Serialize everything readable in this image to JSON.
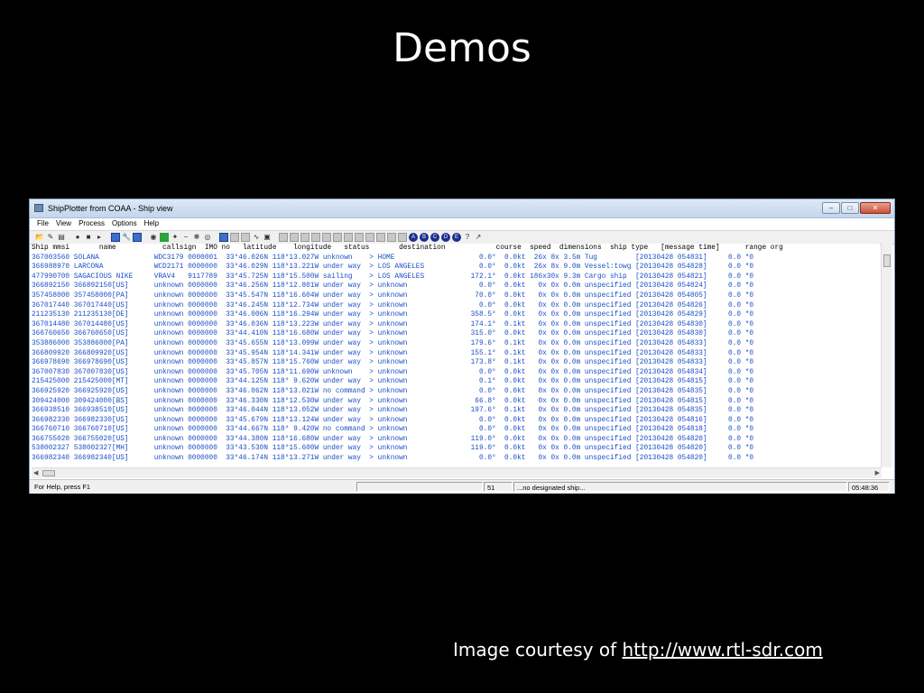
{
  "slide": {
    "title": "Demos",
    "caption_prefix": "Image courtesy of",
    "caption_link": "http://www.rtl-sdr.com"
  },
  "window": {
    "title": "ShipPlotter from COAA - Ship view",
    "controls": [
      "minimize-icon",
      "maximize-icon",
      "close-icon"
    ]
  },
  "menu": [
    "File",
    "View",
    "Process",
    "Options",
    "Help"
  ],
  "table": {
    "header": "Ship mmsi       name           callsign  IMO no   latitude    longitude   status       destination            course  speed  dimensions  ship type   [message time]      range org",
    "rows": [
      "367003560 SOLANA             WDC3179 0000001  33°46.026N 118°13.027W unknown    > HOME                    0.0°  0.0kt  26x 8x 3.5m Tug         [20130428 054831]     0.0 *0",
      "366988970 LARCONA            WCD2171 0000000  33°46.029N 118°13.221W under way  > LOS ANGELES             0.0°  0.0kt  26x 8x 9.0m Vessel:towg [20130428 054828]     0.0 *0",
      "477990700 SAGACIOUS NIKE     VRAV4   9117789  33°45.725N 118°15.500W sailing    > LOS ANGELES           172.1°  0.0kt 186x30x 9.3m Cargo ship  [20130428 054821]     0.0 *0",
      "366892150 366892150[US]      unknown 0000000  33°46.256N 118°12.801W under way  > unknown                 0.0°  0.0kt   0x 0x 0.0m unspecified [20130428 054824]     0.0 *0",
      "357458000 357458000[PA]      unknown 0000000  33°45.547N 118°16.604W under way  > unknown                70.0°  0.0kt   0x 0x 0.0m unspecified [20130428 054805]     0.0 *0",
      "367017440 367017440[US]      unknown 0000000  33°46.245N 118°12.734W under way  > unknown                 0.0°  0.0kt   0x 0x 0.0m unspecified [20130428 054826]     0.0 *0",
      "211235130 211235130[DE]      unknown 0000000  33°46.006N 118°16.294W under way  > unknown               358.5°  0.0kt   0x 0x 0.0m unspecified [20130428 054829]     0.0 *0",
      "367014480 367014480[US]      unknown 0000000  33°46.036N 118°13.223W under way  > unknown               174.1°  0.1kt   0x 0x 0.0m unspecified [20130428 054830]     0.0 *0",
      "366760650 366760650[US]      unknown 0000000  33°44.410N 118°16.680W under way  > unknown               315.0°  0.0kt   0x 0x 0.0m unspecified [20130428 054830]     0.0 *0",
      "353886000 353886000[PA]      unknown 0000000  33°45.655N 118°13.099W under way  > unknown               179.6°  0.1kt   0x 0x 0.0m unspecified [20130428 054833]     0.0 *0",
      "366809920 366809920[US]      unknown 0000000  33°45.954N 118°14.341W under way  > unknown               155.1°  0.1kt   0x 0x 0.0m unspecified [20130428 054833]     0.0 *0",
      "366978690 366978690[US]      unknown 0000000  33°45.857N 118°15.760W under way  > unknown               173.8°  0.1kt   0x 0x 0.0m unspecified [20130428 054833]     0.0 *0",
      "367007830 367007830[US]      unknown 0000000  33°45.705N 118°11.690W unknown    > unknown                 0.0°  0.0kt   0x 0x 0.0m unspecified [20130428 054834]     0.0 *0",
      "215425000 215425000[MT]      unknown 0000000  33°44.125N 118° 9.620W under way  > unknown                 0.1°  0.0kt   0x 0x 0.0m unspecified [20130428 054815]     0.0 *0",
      "366925920 366925920[US]      unknown 0000000  33°46.062N 118°13.021W no command > unknown                 0.0°  0.0kt   0x 0x 0.0m unspecified [20130428 054835]     0.0 *0",
      "309424000 309424000[BS]      unknown 0000000  33°46.330N 118°12.530W under way  > unknown                66.8°  0.0kt   0x 0x 0.0m unspecified [20130428 054815]     0.0 *0",
      "366938510 366938510[US]      unknown 0000000  33°46.044N 118°13.052W under way  > unknown               197.6°  0.1kt   0x 0x 0.0m unspecified [20130428 054835]     0.0 *0",
      "366982330 366982330[US]      unknown 0000000  33°45.679N 118°13.124W under way  > unknown                 0.0°  0.0kt   0x 0x 0.0m unspecified [20130428 054816]     0.0 *0",
      "366760710 366760710[US]      unknown 0000000  33°44.667N 118° 9.420W no command > unknown                 0.0°  0.0kt   0x 0x 0.0m unspecified [20130428 054818]     0.0 *0",
      "366755020 366755020[US]      unknown 0000000  33°44.380N 118°16.680W under way  > unknown               119.0°  0.0kt   0x 0x 0.0m unspecified [20130428 054820]     0.0 *0",
      "538002327 538002327[MH]      unknown 0000000  33°43.530N 118°15.600W under way  > unknown               119.0°  0.0kt   0x 0x 0.0m unspecified [20130428 054820]     0.0 *0",
      "366982340 366982340[US]      unknown 0000000  33°46.174N 118°13.271W under way  > unknown                 0.0°  0.0kt   0x 0x 0.0m unspecified [20130428 054820]     0.0 *0"
    ]
  },
  "statusbar": {
    "help": "For Help, press F1",
    "count": "51",
    "ship": "...no designated ship...",
    "time": "05:48:36"
  }
}
